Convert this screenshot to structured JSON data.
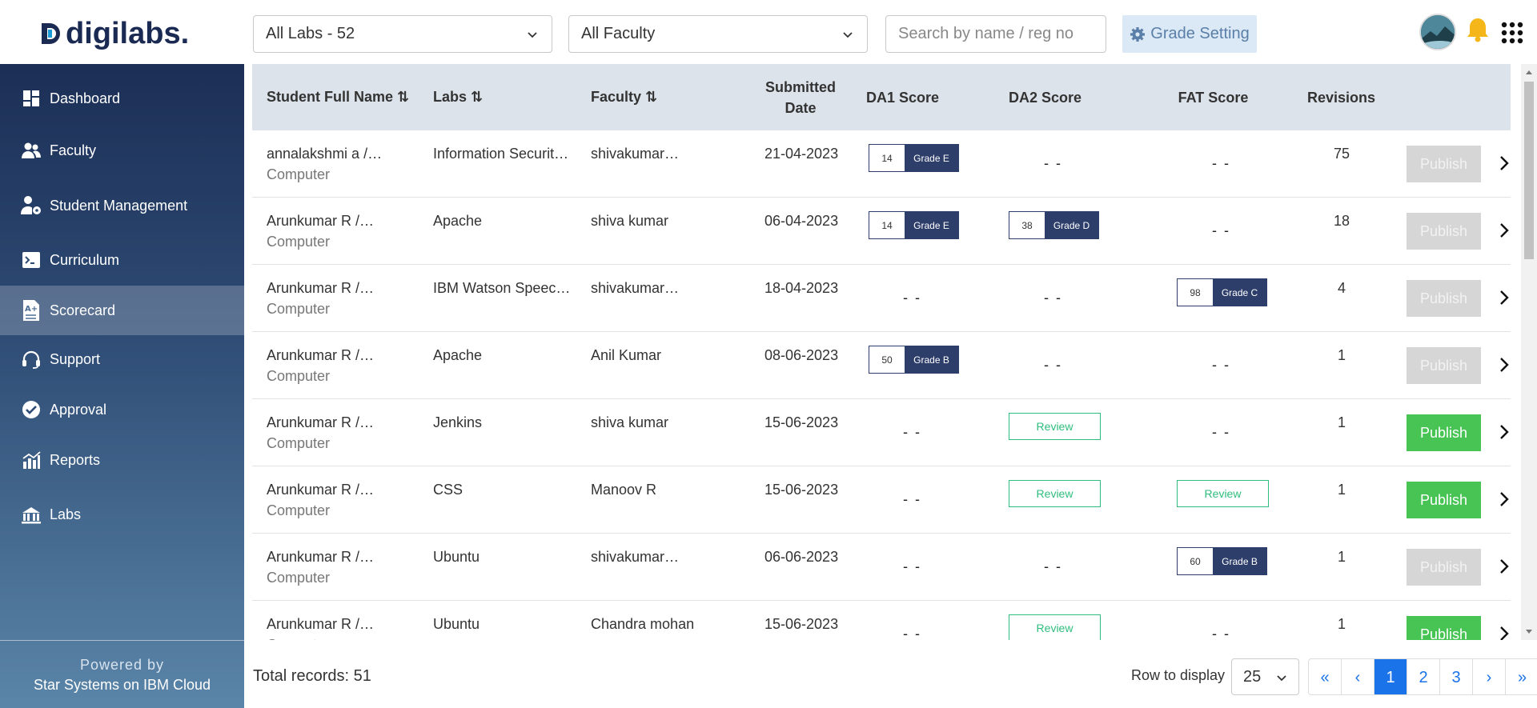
{
  "brand": {
    "name": "digilabs.",
    "accent": "#1a73e8",
    "navy": "#1b2a52"
  },
  "header": {
    "labs_filter": "All Labs - 52",
    "faculty_filter": "All Faculty",
    "search_placeholder": "Search by name / reg no",
    "grade_setting_label": "Grade Setting"
  },
  "sidebar": {
    "items": [
      {
        "label": "Dashboard",
        "icon": "dashboard-icon",
        "active": false
      },
      {
        "label": "Faculty",
        "icon": "people-icon",
        "active": false
      },
      {
        "label": "Student Management",
        "icon": "user-gear-icon",
        "active": false
      },
      {
        "label": "Curriculum",
        "icon": "terminal-icon",
        "active": false
      },
      {
        "label": "Scorecard",
        "icon": "scorecard-icon",
        "active": true
      },
      {
        "label": "Support",
        "icon": "headset-icon",
        "active": false
      },
      {
        "label": "Approval",
        "icon": "check-circle-icon",
        "active": false
      },
      {
        "label": "Reports",
        "icon": "chart-icon",
        "active": false
      },
      {
        "label": "Labs",
        "icon": "labs-icon",
        "active": false
      }
    ],
    "footer_line1": "Powered by",
    "footer_line2": "Star Systems on IBM Cloud"
  },
  "table": {
    "headers": {
      "student": "Student Full Name",
      "labs": "Labs",
      "faculty": "Faculty",
      "submitted": "Submitted Date",
      "da1": "DA1 Score",
      "da2": "DA2 Score",
      "fat": "FAT Score",
      "revisions": "Revisions"
    },
    "rows": [
      {
        "name": "annalakshmi a /…",
        "dept": "Computer",
        "lab": "Information Securit…",
        "faculty": "shivakumar…",
        "date": "21-04-2023",
        "da1": {
          "score": "14",
          "grade": "Grade E"
        },
        "da2": "- -",
        "fat": "- -",
        "revisions": "75",
        "publish": "Publish",
        "publish_enabled": false
      },
      {
        "name": "Arunkumar R /…",
        "dept": "Computer",
        "lab": "Apache",
        "faculty": "shiva kumar",
        "date": "06-04-2023",
        "da1": {
          "score": "14",
          "grade": "Grade E"
        },
        "da2": {
          "score": "38",
          "grade": "Grade D"
        },
        "fat": "- -",
        "revisions": "18",
        "publish": "Publish",
        "publish_enabled": false
      },
      {
        "name": "Arunkumar R /…",
        "dept": "Computer",
        "lab": "IBM Watson Speec…",
        "faculty": "shivakumar…",
        "date": "18-04-2023",
        "da1": "- -",
        "da2": "- -",
        "fat": {
          "score": "98",
          "grade": "Grade C"
        },
        "revisions": "4",
        "publish": "Publish",
        "publish_enabled": false
      },
      {
        "name": "Arunkumar R /…",
        "dept": "Computer",
        "lab": "Apache",
        "faculty": "Anil Kumar",
        "date": "08-06-2023",
        "da1": {
          "score": "50",
          "grade": "Grade B"
        },
        "da2": "- -",
        "fat": "- -",
        "revisions": "1",
        "publish": "Publish",
        "publish_enabled": false
      },
      {
        "name": "Arunkumar R /…",
        "dept": "Computer",
        "lab": "Jenkins",
        "faculty": "shiva kumar",
        "date": "15-06-2023",
        "da1": "- -",
        "da2": "Review",
        "fat": "- -",
        "revisions": "1",
        "publish": "Publish",
        "publish_enabled": true
      },
      {
        "name": "Arunkumar R /…",
        "dept": "Computer",
        "lab": "CSS",
        "faculty": "Manoov R",
        "date": "15-06-2023",
        "da1": "- -",
        "da2": "Review",
        "fat": "Review",
        "revisions": "1",
        "publish": "Publish",
        "publish_enabled": true
      },
      {
        "name": "Arunkumar R /…",
        "dept": "Computer",
        "lab": "Ubuntu",
        "faculty": "shivakumar…",
        "date": "06-06-2023",
        "da1": "- -",
        "da2": "- -",
        "fat": {
          "score": "60",
          "grade": "Grade B"
        },
        "revisions": "1",
        "publish": "Publish",
        "publish_enabled": false
      },
      {
        "name": "Arunkumar R /…",
        "dept": "Computer",
        "lab": "Ubuntu",
        "faculty": "Chandra mohan",
        "date": "15-06-2023",
        "da1": "- -",
        "da2": "Review",
        "fat": "- -",
        "revisions": "1",
        "publish": "Publish",
        "publish_enabled": true
      }
    ]
  },
  "footer": {
    "total_records": "Total records: 51",
    "rows_label": "Row to display",
    "rows_value": "25",
    "pages": [
      "«",
      "‹",
      "1",
      "2",
      "3",
      "›",
      "»"
    ],
    "active_page": "1"
  }
}
